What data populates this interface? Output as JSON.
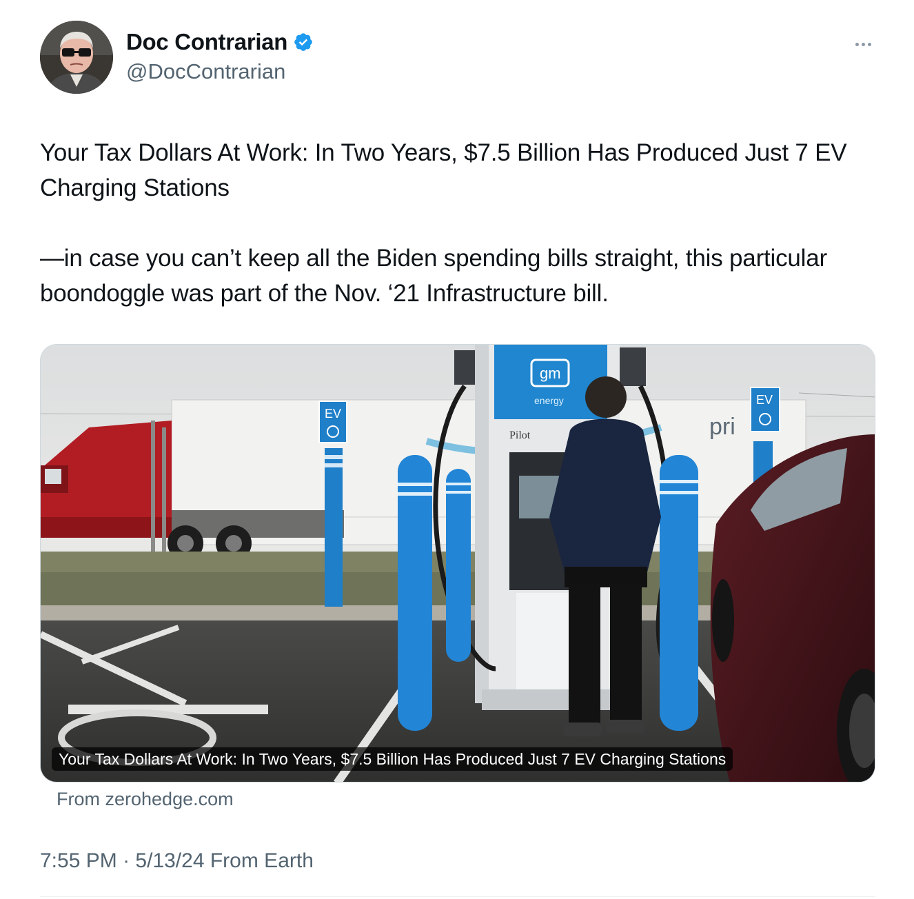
{
  "author": {
    "display_name": "Doc Contrarian",
    "handle": "@DocContrarian",
    "verified": true
  },
  "tweet": {
    "paragraphs": [
      "Your Tax Dollars At Work: In Two Years, $7.5 Billion Has Produced Just 7 EV Charging Stations",
      "—in case you can’t keep all the Biden spending bills straight, this particular boondoggle was part of the Nov. ‘21 Infrastructure bill."
    ]
  },
  "card": {
    "caption": "Your Tax Dollars At Work: In Two Years, $7.5 Billion Has Produced Just 7 EV Charging Stations",
    "source": "From zerohedge.com",
    "image_text": {
      "brand": "gm",
      "brand_sub": "energy",
      "ev_sign": "EV",
      "pilot": "Pilot",
      "trailer": "pri"
    }
  },
  "meta": {
    "time": "7:55 PM",
    "separator": "·",
    "date": "5/13/24",
    "location": "From Earth"
  },
  "icons": {
    "verified": "verified-badge-icon",
    "more": "more-options-icon"
  },
  "colors": {
    "verified_blue": "#1d9bf0",
    "text_primary": "#0f1419",
    "text_secondary": "#536471"
  }
}
